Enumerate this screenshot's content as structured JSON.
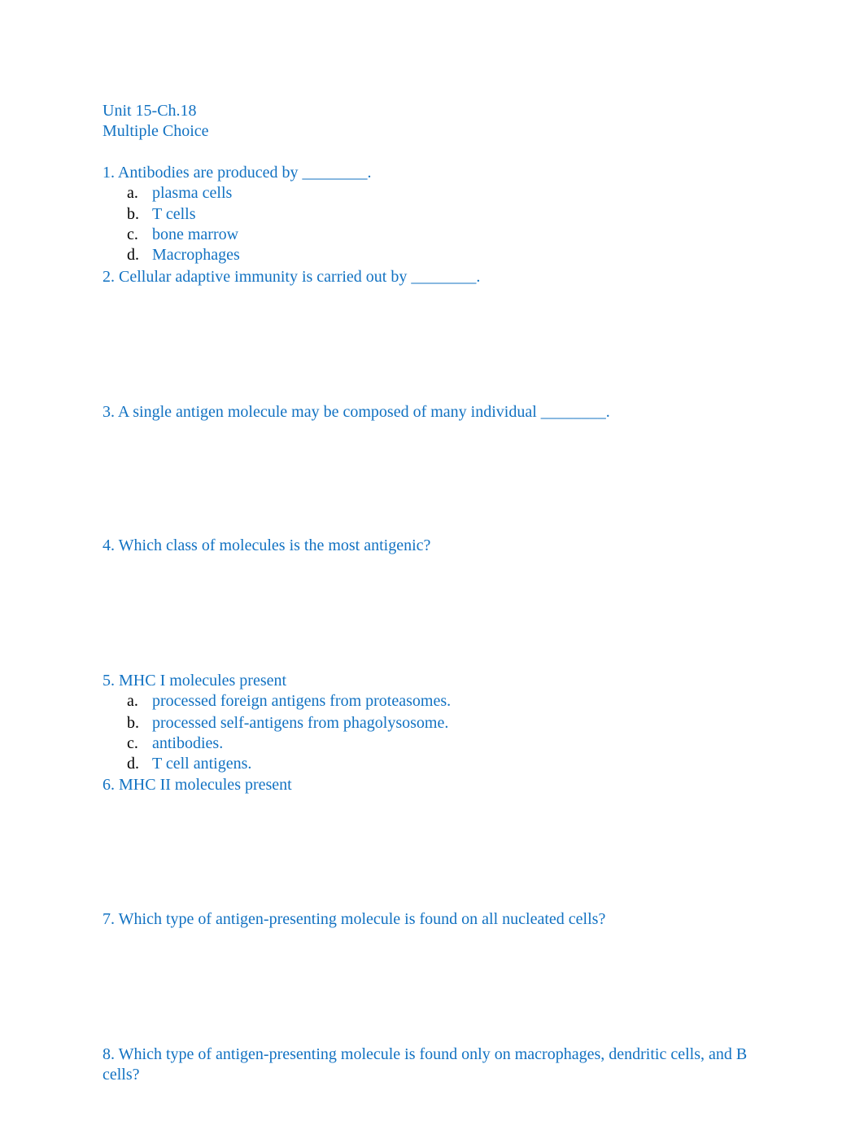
{
  "header": {
    "unit": "Unit 15-Ch.18",
    "section": "Multiple Choice"
  },
  "questions": [
    {
      "text": "1. Antibodies are produced by ________.",
      "options": [
        {
          "letter": "a.",
          "text": "plasma cells"
        },
        {
          "letter": "b.",
          "text": "T cells"
        },
        {
          "letter": "c.",
          "text": "bone marrow"
        },
        {
          "letter": "d.",
          "text": "Macrophages"
        }
      ]
    },
    {
      "text": "2. Cellular adaptive immunity is carried out by ________."
    },
    {
      "text": "3. A single antigen molecule may be composed of many individual ________."
    },
    {
      "text": "4. Which class of molecules is the most antigenic?"
    },
    {
      "text": "5. MHC I molecules present",
      "options": [
        {
          "letter": "a.",
          "text": "processed foreign antigens from proteasomes."
        },
        {
          "letter": "b.",
          "text": "processed self-antigens from phagolysosome."
        },
        {
          "letter": "c.",
          "text": "antibodies."
        },
        {
          "letter": "d.",
          "text": "T cell antigens."
        }
      ]
    },
    {
      "text": "6. MHC II molecules present"
    },
    {
      "text": "7. Which type of antigen-presenting molecule is found on all nucleated cells?"
    },
    {
      "text": "8. Which type of antigen-presenting molecule is found only on macrophages, dendritic cells, and B cells?"
    }
  ],
  "colors": {
    "text": "#1272c2",
    "list_marker": "#000000"
  }
}
